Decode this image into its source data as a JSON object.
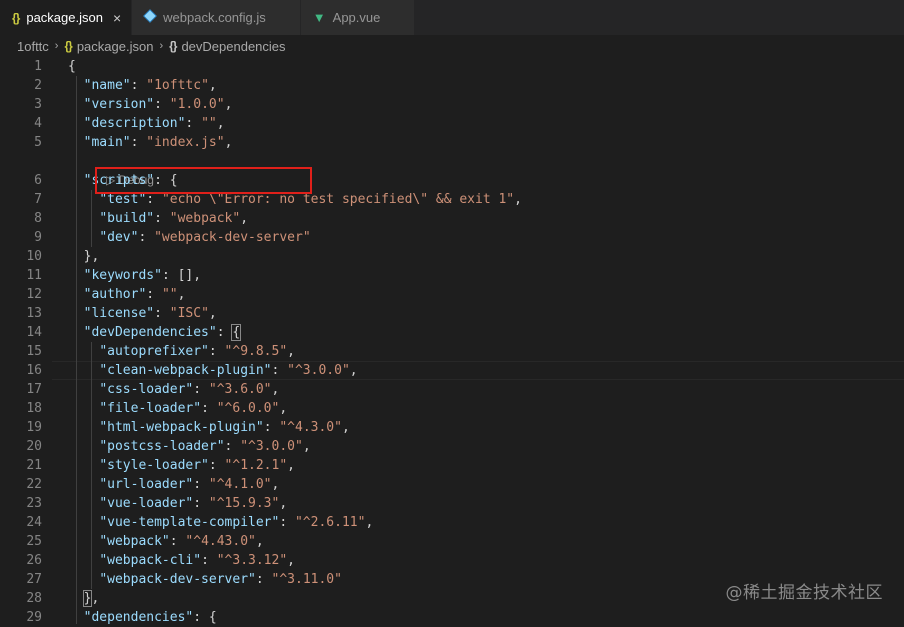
{
  "tabs": [
    {
      "label": "package.json",
      "icon": "json-braces-icon",
      "icon_text": "{}",
      "active": true,
      "close": "×"
    },
    {
      "label": "webpack.config.js",
      "icon": "webpack-icon",
      "active": false
    },
    {
      "label": "App.vue",
      "icon": "vue-icon",
      "icon_text": "▼",
      "active": false
    }
  ],
  "breadcrumb": {
    "folder": "1ofttc",
    "file": "package.json",
    "file_icon_text": "{}",
    "symbol": "devDependencies",
    "symbol_icon_text": "{}",
    "separator": "›"
  },
  "codelens": {
    "icon": "▷",
    "label": "Debug"
  },
  "editor": {
    "line_numbers": [
      "1",
      "2",
      "3",
      "4",
      "5",
      "6",
      "7",
      "8",
      "9",
      "10",
      "11",
      "12",
      "13",
      "14",
      "15",
      "16",
      "17",
      "18",
      "19",
      "20",
      "21",
      "22",
      "23",
      "24",
      "25",
      "26",
      "27",
      "28",
      "29"
    ],
    "lines": [
      [
        [
          "p",
          "{"
        ]
      ],
      [
        [
          "p",
          "  "
        ],
        [
          "k",
          "\"name\""
        ],
        [
          "p",
          ": "
        ],
        [
          "s",
          "\"1ofttc\""
        ],
        [
          "p",
          ","
        ]
      ],
      [
        [
          "p",
          "  "
        ],
        [
          "k",
          "\"version\""
        ],
        [
          "p",
          ": "
        ],
        [
          "s",
          "\"1.0.0\""
        ],
        [
          "p",
          ","
        ]
      ],
      [
        [
          "p",
          "  "
        ],
        [
          "k",
          "\"description\""
        ],
        [
          "p",
          ": "
        ],
        [
          "s",
          "\"\""
        ],
        [
          "p",
          ","
        ]
      ],
      [
        [
          "p",
          "  "
        ],
        [
          "k",
          "\"main\""
        ],
        [
          "p",
          ": "
        ],
        [
          "s",
          "\"index.js\""
        ],
        [
          "p",
          ","
        ]
      ],
      [
        [
          "p",
          "  "
        ],
        [
          "k",
          "\"scripts\""
        ],
        [
          "p",
          ": {"
        ]
      ],
      [
        [
          "p",
          "    "
        ],
        [
          "k",
          "\"test\""
        ],
        [
          "p",
          ": "
        ],
        [
          "s",
          "\"echo \\\"Error: no test specified\\\" && exit 1\""
        ],
        [
          "p",
          ","
        ]
      ],
      [
        [
          "p",
          "    "
        ],
        [
          "k",
          "\"build\""
        ],
        [
          "p",
          ": "
        ],
        [
          "s",
          "\"webpack\""
        ],
        [
          "p",
          ","
        ]
      ],
      [
        [
          "p",
          "    "
        ],
        [
          "k",
          "\"dev\""
        ],
        [
          "p",
          ": "
        ],
        [
          "s",
          "\"webpack-dev-server\""
        ]
      ],
      [
        [
          "p",
          "  },"
        ]
      ],
      [
        [
          "p",
          "  "
        ],
        [
          "k",
          "\"keywords\""
        ],
        [
          "p",
          ": [],"
        ]
      ],
      [
        [
          "p",
          "  "
        ],
        [
          "k",
          "\"author\""
        ],
        [
          "p",
          ": "
        ],
        [
          "s",
          "\"\""
        ],
        [
          "p",
          ","
        ]
      ],
      [
        [
          "p",
          "  "
        ],
        [
          "k",
          "\"license\""
        ],
        [
          "p",
          ": "
        ],
        [
          "s",
          "\"ISC\""
        ],
        [
          "p",
          ","
        ]
      ],
      [
        [
          "p",
          "  "
        ],
        [
          "k",
          "\"devDependencies\""
        ],
        [
          "p",
          ": "
        ],
        [
          "b",
          "{"
        ]
      ],
      [
        [
          "p",
          "    "
        ],
        [
          "k",
          "\"autoprefixer\""
        ],
        [
          "p",
          ": "
        ],
        [
          "s",
          "\"^9.8.5\""
        ],
        [
          "p",
          ","
        ]
      ],
      [
        [
          "p",
          "    "
        ],
        [
          "k",
          "\"clean-webpack-plugin\""
        ],
        [
          "p",
          ": "
        ],
        [
          "s",
          "\"^3.0.0\""
        ],
        [
          "p",
          ","
        ]
      ],
      [
        [
          "p",
          "    "
        ],
        [
          "k",
          "\"css-loader\""
        ],
        [
          "p",
          ": "
        ],
        [
          "s",
          "\"^3.6.0\""
        ],
        [
          "p",
          ","
        ]
      ],
      [
        [
          "p",
          "    "
        ],
        [
          "k",
          "\"file-loader\""
        ],
        [
          "p",
          ": "
        ],
        [
          "s",
          "\"^6.0.0\""
        ],
        [
          "p",
          ","
        ]
      ],
      [
        [
          "p",
          "    "
        ],
        [
          "k",
          "\"html-webpack-plugin\""
        ],
        [
          "p",
          ": "
        ],
        [
          "s",
          "\"^4.3.0\""
        ],
        [
          "p",
          ","
        ]
      ],
      [
        [
          "p",
          "    "
        ],
        [
          "k",
          "\"postcss-loader\""
        ],
        [
          "p",
          ": "
        ],
        [
          "s",
          "\"^3.0.0\""
        ],
        [
          "p",
          ","
        ]
      ],
      [
        [
          "p",
          "    "
        ],
        [
          "k",
          "\"style-loader\""
        ],
        [
          "p",
          ": "
        ],
        [
          "s",
          "\"^1.2.1\""
        ],
        [
          "p",
          ","
        ]
      ],
      [
        [
          "p",
          "    "
        ],
        [
          "k",
          "\"url-loader\""
        ],
        [
          "p",
          ": "
        ],
        [
          "s",
          "\"^4.1.0\""
        ],
        [
          "p",
          ","
        ]
      ],
      [
        [
          "p",
          "    "
        ],
        [
          "k",
          "\"vue-loader\""
        ],
        [
          "p",
          ": "
        ],
        [
          "s",
          "\"^15.9.3\""
        ],
        [
          "p",
          ","
        ]
      ],
      [
        [
          "p",
          "    "
        ],
        [
          "k",
          "\"vue-template-compiler\""
        ],
        [
          "p",
          ": "
        ],
        [
          "s",
          "\"^2.6.11\""
        ],
        [
          "p",
          ","
        ]
      ],
      [
        [
          "p",
          "    "
        ],
        [
          "k",
          "\"webpack\""
        ],
        [
          "p",
          ": "
        ],
        [
          "s",
          "\"^4.43.0\""
        ],
        [
          "p",
          ","
        ]
      ],
      [
        [
          "p",
          "    "
        ],
        [
          "k",
          "\"webpack-cli\""
        ],
        [
          "p",
          ": "
        ],
        [
          "s",
          "\"^3.3.12\""
        ],
        [
          "p",
          ","
        ]
      ],
      [
        [
          "p",
          "    "
        ],
        [
          "k",
          "\"webpack-dev-server\""
        ],
        [
          "p",
          ": "
        ],
        [
          "s",
          "\"^3.11.0\""
        ]
      ],
      [
        [
          "p",
          "  "
        ],
        [
          "b",
          "}"
        ],
        [
          "p",
          ","
        ]
      ],
      [
        [
          "p",
          "  "
        ],
        [
          "k",
          "\"dependencies\""
        ],
        [
          "p",
          ": {"
        ]
      ]
    ]
  },
  "watermark": "@稀土掘金技术社区",
  "colors": {
    "background": "#1e1e1e",
    "json_key": "#9cdcfe",
    "json_string": "#ce9178",
    "highlight_box": "#e0201a"
  }
}
